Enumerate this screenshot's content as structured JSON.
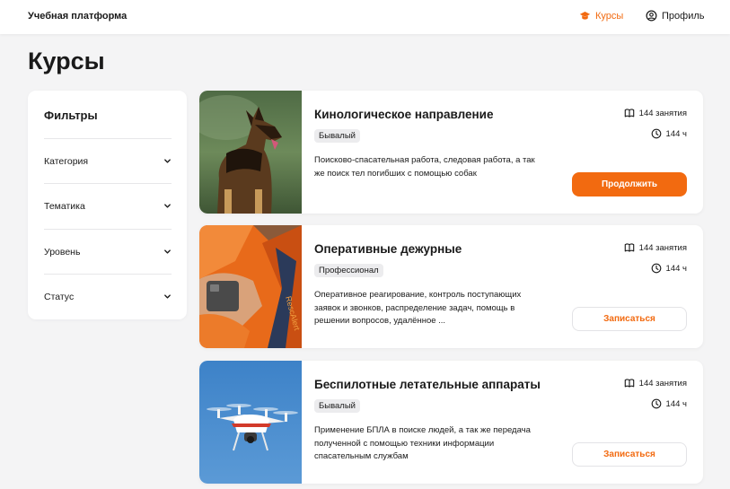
{
  "header": {
    "brand": "Учебная платформа",
    "nav": [
      {
        "label": "Курсы",
        "icon": "graduation-cap-icon",
        "active": true
      },
      {
        "label": "Профиль",
        "icon": "user-circle-icon",
        "active": false
      }
    ]
  },
  "page": {
    "title": "Курсы"
  },
  "filters": {
    "title": "Фильтры",
    "items": [
      {
        "label": "Категория",
        "icon": "chevron-down-icon"
      },
      {
        "label": "Тематика",
        "icon": "chevron-down-icon"
      },
      {
        "label": "Уровень",
        "icon": "chevron-down-icon"
      },
      {
        "label": "Статус",
        "icon": "chevron-down-icon"
      }
    ]
  },
  "courses": [
    {
      "title": "Кинологическое направление",
      "level": "Бывалый",
      "description": "Поисково-спасательная работа, следовая работа, а так же поиск тел погибших с помощью собак",
      "lessons": "144 занятия",
      "hours": "144 ч",
      "button": "Продолжить",
      "button_style": "primary",
      "image": "dog-photo"
    },
    {
      "title": "Оперативные дежурные",
      "level": "Профессионал",
      "description": "Оперативное реагирование, контроль поступающих заявок и звонков, распределение задач, помощь в решении вопросов, удалённое ...",
      "lessons": "144 занятия",
      "hours": "144 ч",
      "button": "Записаться",
      "button_style": "outline",
      "image": "radio-operator-photo"
    },
    {
      "title": "Беспилотные летательные аппараты",
      "level": "Бывалый",
      "description": "Применение БПЛА в поиске людей, а так же передача полученной с помощью техники информации спасательным службам",
      "lessons": "144 занятия",
      "hours": "144 ч",
      "button": "Записаться",
      "button_style": "outline",
      "image": "drone-photo"
    }
  ],
  "colors": {
    "accent": "#f26a10",
    "background": "#f4f4f5",
    "card": "#ffffff",
    "badge": "#ececee"
  }
}
